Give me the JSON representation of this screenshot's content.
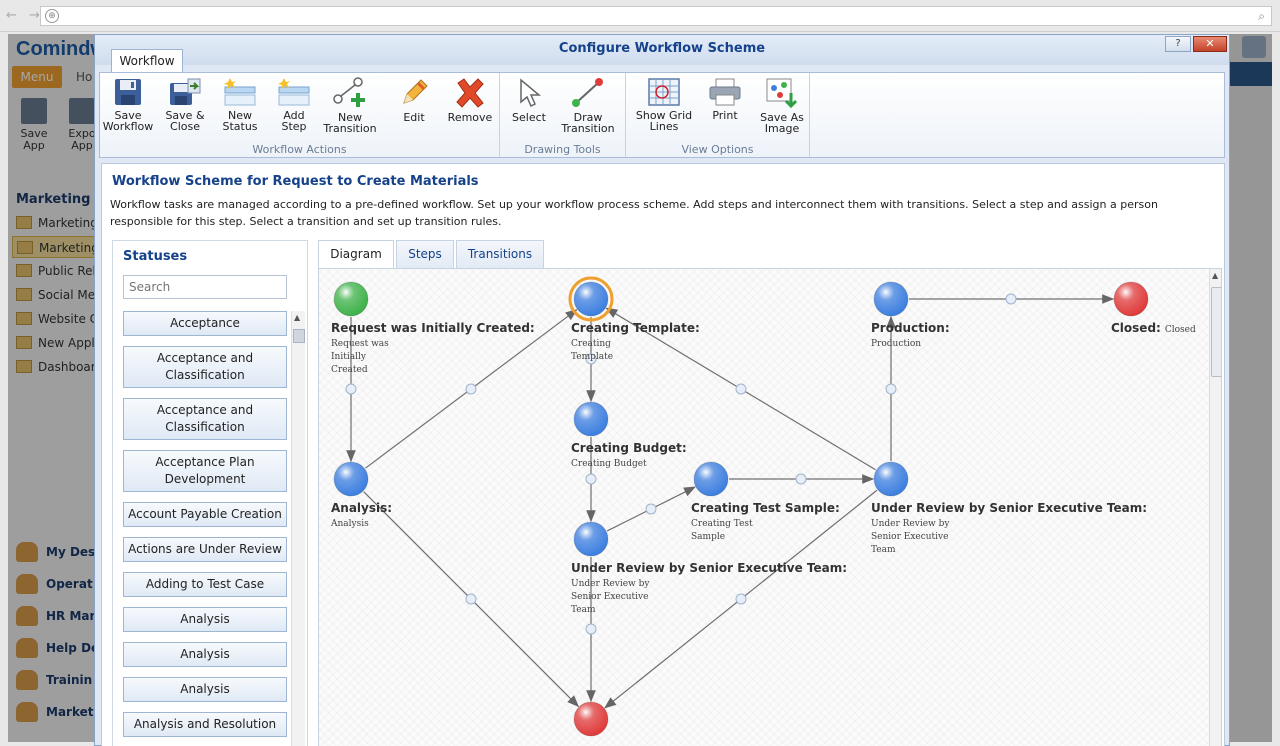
{
  "background_app": {
    "logo": "Comindw",
    "menu_label": "Menu",
    "home_partial": "Ho",
    "toolbar": [
      {
        "label": "Save\nApp"
      },
      {
        "label": "Expo\nApp"
      }
    ],
    "sidebar_title": "Marketing",
    "sidebar_items": [
      {
        "label": "Marketing"
      },
      {
        "label": "Marketing"
      },
      {
        "label": "Public Rel"
      },
      {
        "label": "Social Me"
      },
      {
        "label": "Website C"
      },
      {
        "label": "New Appl"
      },
      {
        "label": "Dashboar"
      }
    ],
    "bottom_items": [
      {
        "label": "My Des"
      },
      {
        "label": "Operat"
      },
      {
        "label": "HR Man"
      },
      {
        "label": "Help De"
      },
      {
        "label": "Trainin"
      },
      {
        "label": "Market"
      }
    ]
  },
  "dialog": {
    "title": "Configure Workflow Scheme",
    "help_label": "?",
    "close_label": "✕",
    "ribbon_tab": "Workflow",
    "groups": [
      {
        "label": "Workflow Actions",
        "buttons": [
          {
            "label": "Save\nWorkflow",
            "icon": "save-icon"
          },
          {
            "label": "Save &\nClose",
            "icon": "save-close-icon"
          },
          {
            "label": "New\nStatus",
            "icon": "new-status-icon"
          },
          {
            "label": "Add\nStep",
            "icon": "add-step-icon"
          },
          {
            "label": "New\nTransition",
            "icon": "new-transition-icon"
          },
          {
            "label": "Edit",
            "icon": "edit-pencil-icon"
          },
          {
            "label": "Remove",
            "icon": "remove-x-icon"
          }
        ]
      },
      {
        "label": "Drawing Tools",
        "buttons": [
          {
            "label": "Select",
            "icon": "select-cursor-icon"
          },
          {
            "label": "Draw\nTransition",
            "icon": "draw-transition-icon"
          }
        ]
      },
      {
        "label": "View Options",
        "buttons": [
          {
            "label": "Show Grid\nLines",
            "icon": "grid-lines-icon"
          },
          {
            "label": "Print",
            "icon": "printer-icon"
          },
          {
            "label": "Save As\nImage",
            "icon": "save-image-icon"
          }
        ]
      }
    ],
    "content": {
      "title": "Workflow Scheme for Request to Create Materials",
      "description": "Workflow tasks are managed according to a pre-defined workflow. Set up your workflow process scheme. Add steps and interconnect them with transitions. Select a step and assign a person responsible for this step. Select a transition and set up transition rules."
    },
    "statuses": {
      "title": "Statuses",
      "search_placeholder": "Search",
      "items": [
        "Acceptance",
        "Acceptance and Classification",
        "Acceptance and Classification",
        "Acceptance Plan Development",
        "Account Payable Creation",
        "Actions are Under Review",
        "Adding to Test Case",
        "Analysis",
        "Analysis",
        "Analysis",
        "Analysis and Resolution"
      ]
    },
    "tabs": [
      "Diagram",
      "Steps",
      "Transitions"
    ],
    "active_tab": "Diagram",
    "diagram": {
      "nodes": [
        {
          "id": "n1",
          "title": "Request was Initially Created:",
          "sub": "Request was\nInitially\nCreated",
          "color": "#3fb24a"
        },
        {
          "id": "n2",
          "title": "Creating Template:",
          "sub": "Creating\nTemplate",
          "color": "#3d7fe0"
        },
        {
          "id": "n3",
          "title": "Production:",
          "sub": "Production",
          "color": "#3d7fe0"
        },
        {
          "id": "n4",
          "title": "Closed:",
          "sub_inline": "Closed",
          "color": "#e03b3b"
        },
        {
          "id": "n5",
          "title": "Creating Budget:",
          "sub": "Creating Budget",
          "color": "#3d7fe0"
        },
        {
          "id": "n6",
          "title": "Analysis:",
          "sub": "Analysis",
          "color": "#3d7fe0"
        },
        {
          "id": "n7",
          "title": "Creating Test Sample:",
          "sub": "Creating Test\nSample",
          "color": "#3d7fe0"
        },
        {
          "id": "n8",
          "title": "Under Review by Senior Executive Team:",
          "sub": "Under Review by\nSenior Executive\nTeam",
          "color": "#3d7fe0"
        },
        {
          "id": "n9",
          "title": "Under Review by Senior Executive Team:",
          "sub": "Under Review by\nSenior Executive\nTeam",
          "color": "#3d7fe0"
        },
        {
          "id": "n10",
          "title": "",
          "sub": "",
          "color": "#e03b3b"
        }
      ],
      "transitions": [
        [
          "n1",
          "n6"
        ],
        [
          "n6",
          "n2"
        ],
        [
          "n2",
          "n5"
        ],
        [
          "n5",
          "n9"
        ],
        [
          "n9",
          "n7"
        ],
        [
          "n7",
          "n8"
        ],
        [
          "n8",
          "n3"
        ],
        [
          "n8",
          "n2"
        ],
        [
          "n3",
          "n4"
        ],
        [
          "n6",
          "n10"
        ],
        [
          "n9",
          "n10"
        ],
        [
          "n8",
          "n10"
        ]
      ]
    }
  }
}
